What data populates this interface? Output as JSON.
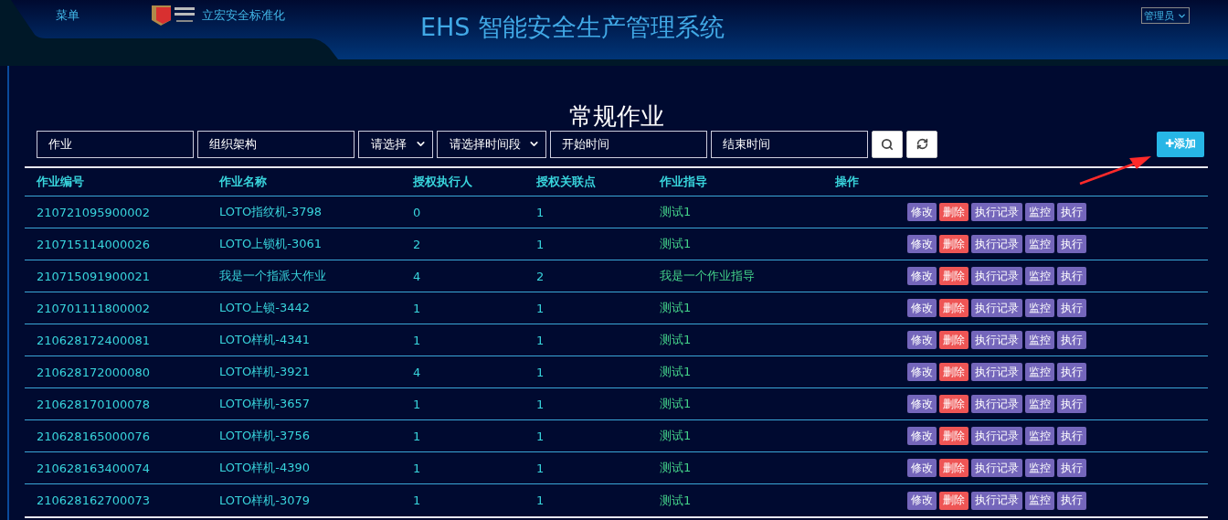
{
  "header": {
    "menu": "菜单",
    "brand": "立宏安全标准化",
    "title": "EHS 智能安全生产管理系统",
    "user": "管理员"
  },
  "page_title": "常规作业",
  "filters": [
    {
      "kind": "input",
      "placeholder": "作业"
    },
    {
      "kind": "input",
      "placeholder": "组织架构"
    },
    {
      "kind": "select",
      "value": "请选择"
    },
    {
      "kind": "select",
      "value": "请选择时间段"
    },
    {
      "kind": "input",
      "placeholder": "开始时间"
    },
    {
      "kind": "input",
      "placeholder": "结束时间"
    }
  ],
  "add_button": "✚添加",
  "table": {
    "columns": [
      "作业编号",
      "作业名称",
      "授权执行人",
      "授权关联点",
      "作业指导",
      "操作"
    ],
    "rows": [
      {
        "id": "210721095900002",
        "name": "LOTO指纹机-3798",
        "executors": "0",
        "points": "1",
        "guide": "测试1",
        "actions": [
          {
            "label": "修改",
            "kind": "normal"
          },
          {
            "label": "删除",
            "kind": "danger"
          },
          {
            "label": "执行记录",
            "kind": "normal"
          },
          {
            "label": "监控",
            "kind": "normal"
          },
          {
            "label": "执行",
            "kind": "normal"
          }
        ]
      },
      {
        "id": "210715114000026",
        "name": "LOTO上锁机-3061",
        "executors": "2",
        "points": "1",
        "guide": "测试1",
        "actions": [
          {
            "label": "修改",
            "kind": "normal"
          },
          {
            "label": "删除",
            "kind": "danger"
          },
          {
            "label": "执行记录",
            "kind": "normal"
          },
          {
            "label": "监控",
            "kind": "normal"
          },
          {
            "label": "执行",
            "kind": "normal"
          }
        ]
      },
      {
        "id": "210715091900021",
        "name": "我是一个指派大作业",
        "executors": "4",
        "points": "2",
        "guide": "我是一个作业指导",
        "actions": [
          {
            "label": "修改",
            "kind": "normal"
          },
          {
            "label": "删除",
            "kind": "danger"
          },
          {
            "label": "执行记录",
            "kind": "normal"
          },
          {
            "label": "监控",
            "kind": "normal"
          },
          {
            "label": "执行",
            "kind": "normal"
          }
        ]
      },
      {
        "id": "210701111800002",
        "name": "LOTO上锁-3442",
        "executors": "1",
        "points": "1",
        "guide": "测试1",
        "actions": [
          {
            "label": "修改",
            "kind": "normal"
          },
          {
            "label": "删除",
            "kind": "danger"
          },
          {
            "label": "执行记录",
            "kind": "normal"
          },
          {
            "label": "监控",
            "kind": "normal"
          },
          {
            "label": "执行",
            "kind": "normal"
          }
        ]
      },
      {
        "id": "210628172400081",
        "name": "LOTO样机-4341",
        "executors": "1",
        "points": "1",
        "guide": "测试1",
        "actions": [
          {
            "label": "修改",
            "kind": "normal"
          },
          {
            "label": "删除",
            "kind": "danger"
          },
          {
            "label": "执行记录",
            "kind": "normal"
          },
          {
            "label": "监控",
            "kind": "normal"
          },
          {
            "label": "执行",
            "kind": "normal"
          }
        ]
      },
      {
        "id": "210628172000080",
        "name": "LOTO样机-3921",
        "executors": "4",
        "points": "1",
        "guide": "测试1",
        "actions": [
          {
            "label": "修改",
            "kind": "normal"
          },
          {
            "label": "删除",
            "kind": "danger"
          },
          {
            "label": "执行记录",
            "kind": "normal"
          },
          {
            "label": "监控",
            "kind": "normal"
          },
          {
            "label": "执行",
            "kind": "normal"
          }
        ]
      },
      {
        "id": "210628170100078",
        "name": "LOTO样机-3657",
        "executors": "1",
        "points": "1",
        "guide": "测试1",
        "actions": [
          {
            "label": "修改",
            "kind": "normal"
          },
          {
            "label": "删除",
            "kind": "danger"
          },
          {
            "label": "执行记录",
            "kind": "normal"
          },
          {
            "label": "监控",
            "kind": "normal"
          },
          {
            "label": "执行",
            "kind": "normal"
          }
        ]
      },
      {
        "id": "210628165000076",
        "name": "LOTO样机-3756",
        "executors": "1",
        "points": "1",
        "guide": "测试1",
        "actions": [
          {
            "label": "修改",
            "kind": "normal"
          },
          {
            "label": "删除",
            "kind": "danger"
          },
          {
            "label": "执行记录",
            "kind": "normal"
          },
          {
            "label": "监控",
            "kind": "normal"
          },
          {
            "label": "执行",
            "kind": "normal"
          }
        ]
      },
      {
        "id": "210628163400074",
        "name": "LOTO样机-4390",
        "executors": "1",
        "points": "1",
        "guide": "测试1",
        "actions": [
          {
            "label": "修改",
            "kind": "normal"
          },
          {
            "label": "删除",
            "kind": "danger"
          },
          {
            "label": "执行记录",
            "kind": "normal"
          },
          {
            "label": "监控",
            "kind": "normal"
          },
          {
            "label": "执行",
            "kind": "normal"
          }
        ]
      },
      {
        "id": "210628162700073",
        "name": "LOTO样机-3079",
        "executors": "1",
        "points": "1",
        "guide": "测试1",
        "actions": [
          {
            "label": "修改",
            "kind": "normal"
          },
          {
            "label": "删除",
            "kind": "danger"
          },
          {
            "label": "执行记录",
            "kind": "normal"
          },
          {
            "label": "监控",
            "kind": "normal"
          },
          {
            "label": "执行",
            "kind": "normal"
          }
        ]
      }
    ]
  }
}
